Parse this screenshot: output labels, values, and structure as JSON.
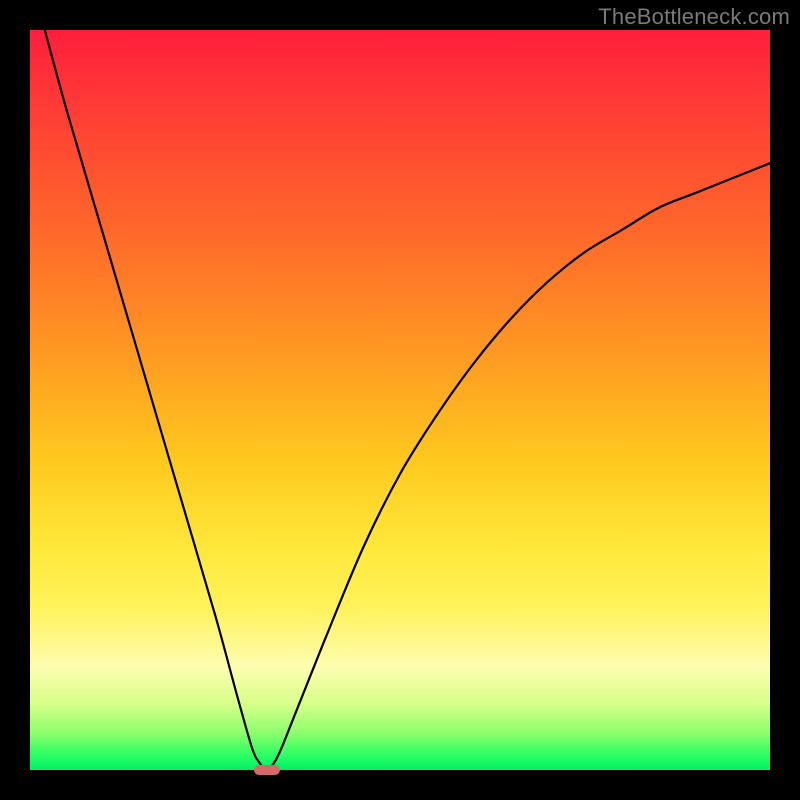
{
  "watermark": "TheBottleneck.com",
  "chart_data": {
    "type": "line",
    "title": "",
    "xlabel": "",
    "ylabel": "",
    "xlim": [
      0,
      100
    ],
    "ylim": [
      0,
      100
    ],
    "grid": false,
    "legend": false,
    "series": [
      {
        "name": "bottleneck-curve",
        "x": [
          2,
          5,
          10,
          15,
          20,
          25,
          28,
          30,
          31,
          32,
          33,
          34,
          36,
          40,
          45,
          50,
          55,
          60,
          65,
          70,
          75,
          80,
          85,
          90,
          95,
          100
        ],
        "values": [
          100,
          89,
          72,
          55,
          38,
          21,
          10,
          3,
          1,
          0,
          1,
          3,
          8,
          18,
          30,
          40,
          48,
          55,
          61,
          66,
          70,
          73,
          76,
          78,
          80,
          82
        ]
      }
    ],
    "marker": {
      "x": 32,
      "y": 0,
      "w": 3.5,
      "h": 1.4,
      "color": "#d66a6a"
    },
    "background_gradient": {
      "stops": [
        {
          "pct": 0,
          "color": "#ff1e3c"
        },
        {
          "pct": 28,
          "color": "#ff6a2a"
        },
        {
          "pct": 58,
          "color": "#ffc81e"
        },
        {
          "pct": 78,
          "color": "#fff25a"
        },
        {
          "pct": 91,
          "color": "#d8ff8a"
        },
        {
          "pct": 100,
          "color": "#00f066"
        }
      ]
    }
  }
}
